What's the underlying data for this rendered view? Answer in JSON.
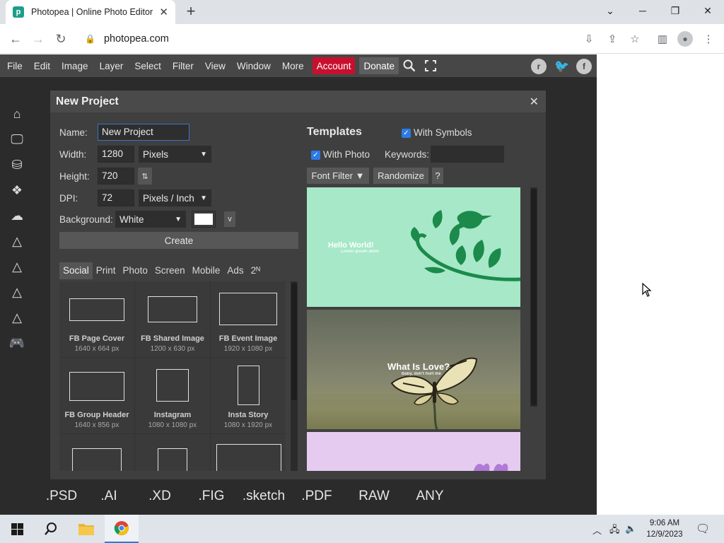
{
  "browser": {
    "tab_title": "Photopea | Online Photo Editor",
    "favicon_letter": "p",
    "url": "photopea.com"
  },
  "menu": {
    "items": [
      "File",
      "Edit",
      "Image",
      "Layer",
      "Select",
      "Filter",
      "View",
      "Window",
      "More"
    ],
    "account": "Account",
    "donate": "Donate",
    "account_color": "#c8102e"
  },
  "social": {
    "reddit": "r",
    "twitter": "t",
    "facebook": "f"
  },
  "formats": [
    ".PSD",
    ".AI",
    ".XD",
    ".FIG",
    ".sketch",
    ".PDF",
    "RAW",
    "ANY"
  ],
  "dialog": {
    "title": "New Project",
    "name_label": "Name:",
    "name_value": "New Project",
    "width_label": "Width:",
    "width_value": "1280",
    "width_unit": "Pixels",
    "height_label": "Height:",
    "height_value": "720",
    "swap_symbol": "⇅",
    "dpi_label": "DPI:",
    "dpi_value": "72",
    "dpi_unit": "Pixels / Inch",
    "background_label": "Background:",
    "background_value": "White",
    "background_color": "#ffffff",
    "bg_menu_label": "v",
    "create_label": "Create",
    "preset_tabs": [
      "Social",
      "Print",
      "Photo",
      "Screen",
      "Mobile",
      "Ads",
      "2ᴺ"
    ],
    "active_preset_tab": "Social",
    "presets": [
      {
        "name": "FB Page Cover",
        "size": "1640 x 664 px"
      },
      {
        "name": "FB Shared Image",
        "size": "1200 x 630 px"
      },
      {
        "name": "FB Event Image",
        "size": "1920 x 1080 px"
      },
      {
        "name": "FB Group Header",
        "size": "1640 x 856 px"
      },
      {
        "name": "Instagram",
        "size": "1080 x 1080 px"
      },
      {
        "name": "Insta Story",
        "size": "1080 x 1920 px"
      },
      {
        "name": "",
        "size": ""
      },
      {
        "name": "",
        "size": ""
      },
      {
        "name": "",
        "size": ""
      }
    ],
    "templates_title": "Templates",
    "with_symbols_label": "With Symbols",
    "with_photo_label": "With Photo",
    "keywords_label": "Keywords:",
    "keywords_value": "",
    "font_filter_label": "Font Filter ▼",
    "randomize_label": "Randomize",
    "help_label": "?",
    "template_cards": [
      {
        "headline": "Hello World!",
        "subline": "Lorem ipsum dolor"
      },
      {
        "headline": "What Is Love?",
        "subline": "Baby, don't hurt me"
      },
      {
        "headline": "",
        "subline": ""
      }
    ]
  },
  "taskbar": {
    "time": "9:06 AM",
    "date": "12/9/2023"
  }
}
